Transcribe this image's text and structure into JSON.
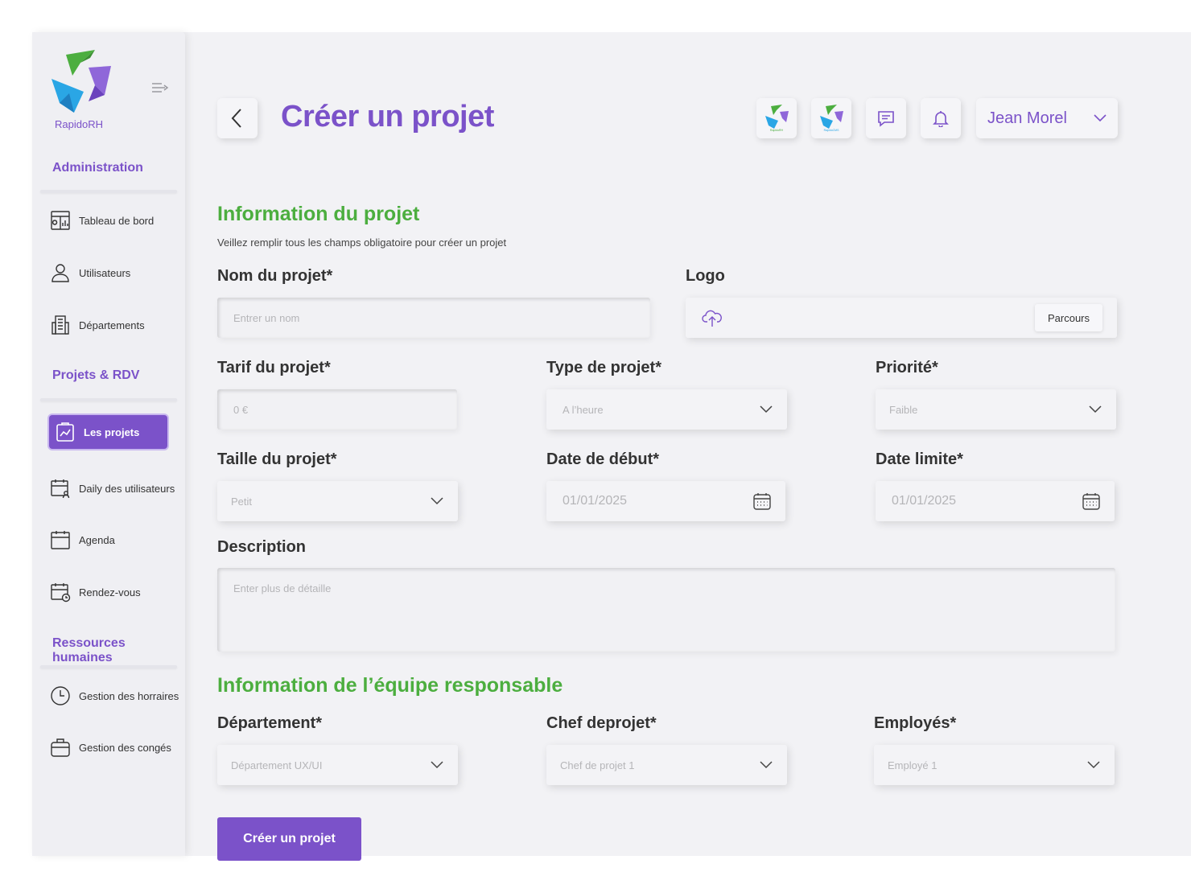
{
  "app": {
    "logo_text": "RapidoRH"
  },
  "sidebar": {
    "sections": [
      {
        "title": "Administration"
      },
      {
        "title": "Projets & RDV"
      },
      {
        "title": "Ressources humaines"
      }
    ],
    "items": [
      {
        "label": "Tableau de bord",
        "icon": "dashboard-icon"
      },
      {
        "label": "Utilisateurs",
        "icon": "user-icon"
      },
      {
        "label": "Départements",
        "icon": "building-icon"
      },
      {
        "label": "Les projets",
        "icon": "clipboard-chart-icon",
        "active": true
      },
      {
        "label": "Daily des utilisateurs",
        "icon": "calendar-user-icon"
      },
      {
        "label": "Agenda",
        "icon": "calendar-icon"
      },
      {
        "label": "Rendez-vous",
        "icon": "calendar-clock-icon"
      },
      {
        "label": "Gestion des horraires",
        "icon": "clock-icon"
      },
      {
        "label": "Gestion des congés",
        "icon": "briefcase-icon"
      }
    ]
  },
  "header": {
    "title": "Créer un projet",
    "app_switch": [
      "RapidoRH",
      "RapidoCMS"
    ],
    "user": "Jean Morel"
  },
  "form": {
    "section1": {
      "title": "Information du projet",
      "hint": "Veillez remplir tous les champs obligatoire pour créer un projet"
    },
    "name": {
      "label": "Nom du projet*",
      "placeholder": "Entrer un nom"
    },
    "logo": {
      "label": "Logo",
      "button": "Parcours"
    },
    "rate": {
      "label": "Tarif du projet*",
      "placeholder": "0 €"
    },
    "type": {
      "label": "Type de projet*",
      "value": "A l’heure"
    },
    "priority": {
      "label": "Priorité*",
      "value": "Faible"
    },
    "size": {
      "label": "Taille du projet*",
      "value": "Petit"
    },
    "start": {
      "label": "Date de début*",
      "value": "01/01/2025"
    },
    "deadline": {
      "label": "Date limite*",
      "value": "01/01/2025"
    },
    "description": {
      "label": "Description",
      "placeholder": "Enter plus de détaille"
    },
    "section2": {
      "title": "Information de l’équipe responsable"
    },
    "department": {
      "label": "Département*",
      "value": "Département UX/UI"
    },
    "manager": {
      "label": "Chef deprojet*",
      "value": "Chef de projet 1"
    },
    "employees": {
      "label": "Employés*",
      "value": "Employé 1"
    },
    "submit": "Créer un projet"
  },
  "colors": {
    "accent": "#7b52c9",
    "section": "#4cae3f",
    "background": "#f2f2f5"
  }
}
